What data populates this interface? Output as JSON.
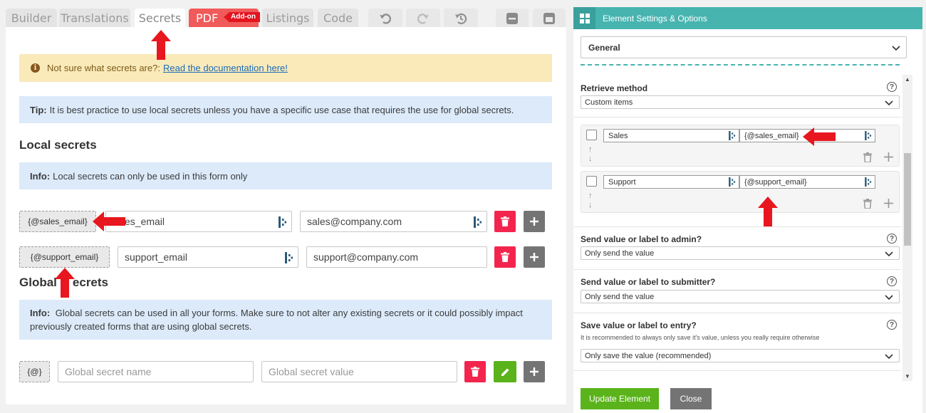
{
  "tabs": {
    "builder": "Builder",
    "translations": "Translations",
    "secrets": "Secrets",
    "pdf": "PDF",
    "pdf_badge": "Add-on",
    "listings": "Listings",
    "code": "Code"
  },
  "notice": {
    "warning_text": "Not sure what secrets are?:",
    "warning_link": "Read the documentation here!",
    "tip_label": "Tip:",
    "tip_text": "It is best practice to use local secrets unless you have a specific use case that requires the use for global secrets."
  },
  "local": {
    "title": "Local secrets",
    "info_label": "Info:",
    "info_text": "Local secrets can only be used in this form only",
    "rows": [
      {
        "tag": "{@sales_email}",
        "name": "es_email",
        "value": "sales@company.com"
      },
      {
        "tag": "{@support_email}",
        "name": "support_email",
        "value": "support@company.com"
      }
    ]
  },
  "global": {
    "title_start": "Global",
    "title_end": "ecrets",
    "info_label": "Info:",
    "info_text": "Global secrets can be used in all your forms. Make sure to not alter any existing secrets or it could possibly impact previously created forms that are using global secrets.",
    "tag": "{@}",
    "name_placeholder": "Global secret name",
    "value_placeholder": "Global secret value"
  },
  "settings": {
    "header": "Element Settings & Options",
    "group": "General",
    "retrieve_label": "Retrieve method",
    "retrieve_value": "Custom items",
    "items": [
      {
        "label": "Sales",
        "value": "{@sales_email}"
      },
      {
        "label": "Support",
        "value": "{@support_email}"
      }
    ],
    "admin_label": "Send value or label to admin?",
    "admin_value": "Only send the value",
    "submitter_label": "Send value or label to submitter?",
    "submitter_value": "Only send the value",
    "entry_label": "Save value or label to entry?",
    "entry_help": "It is recommended to always only save it's value, unless you really require otherwise",
    "entry_value": "Only save the value (recommended)",
    "update_button": "Update Element",
    "close_button": "Close"
  },
  "colors": {
    "accent": "#47b4b0",
    "danger": "#f3254e",
    "success": "#5ab31a",
    "arrow": "#e8161e"
  }
}
